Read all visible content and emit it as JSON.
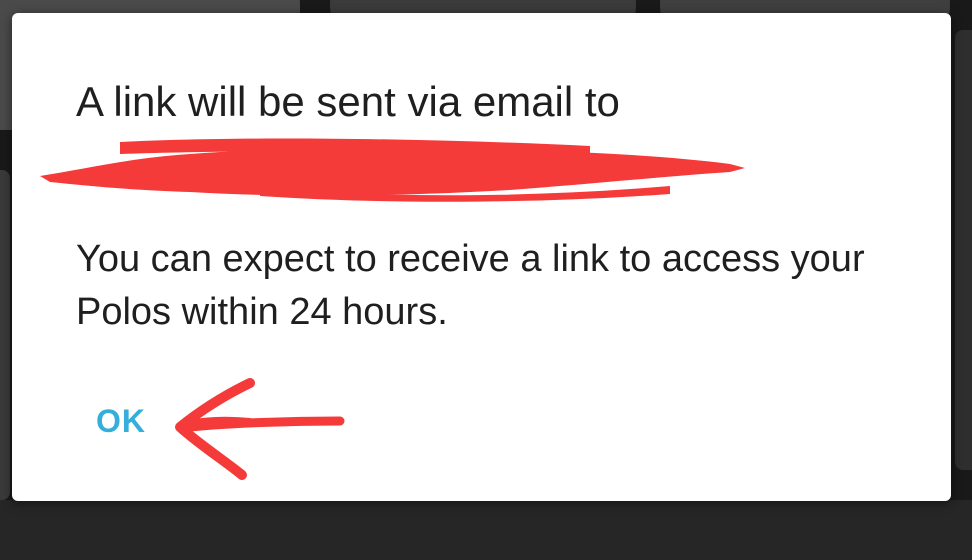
{
  "dialog": {
    "title": "A link will be sent via email to",
    "message": "You can expect to receive a link to access your Polos within 24 hours.",
    "ok_label": "OK"
  },
  "annotations": {
    "redaction_color": "#f53a3a",
    "arrow_color": "#f53a3a"
  },
  "theme": {
    "accent": "#35aedb",
    "text": "#1f1f1f",
    "dialog_background": "#ffffff",
    "backdrop": "#191919"
  }
}
